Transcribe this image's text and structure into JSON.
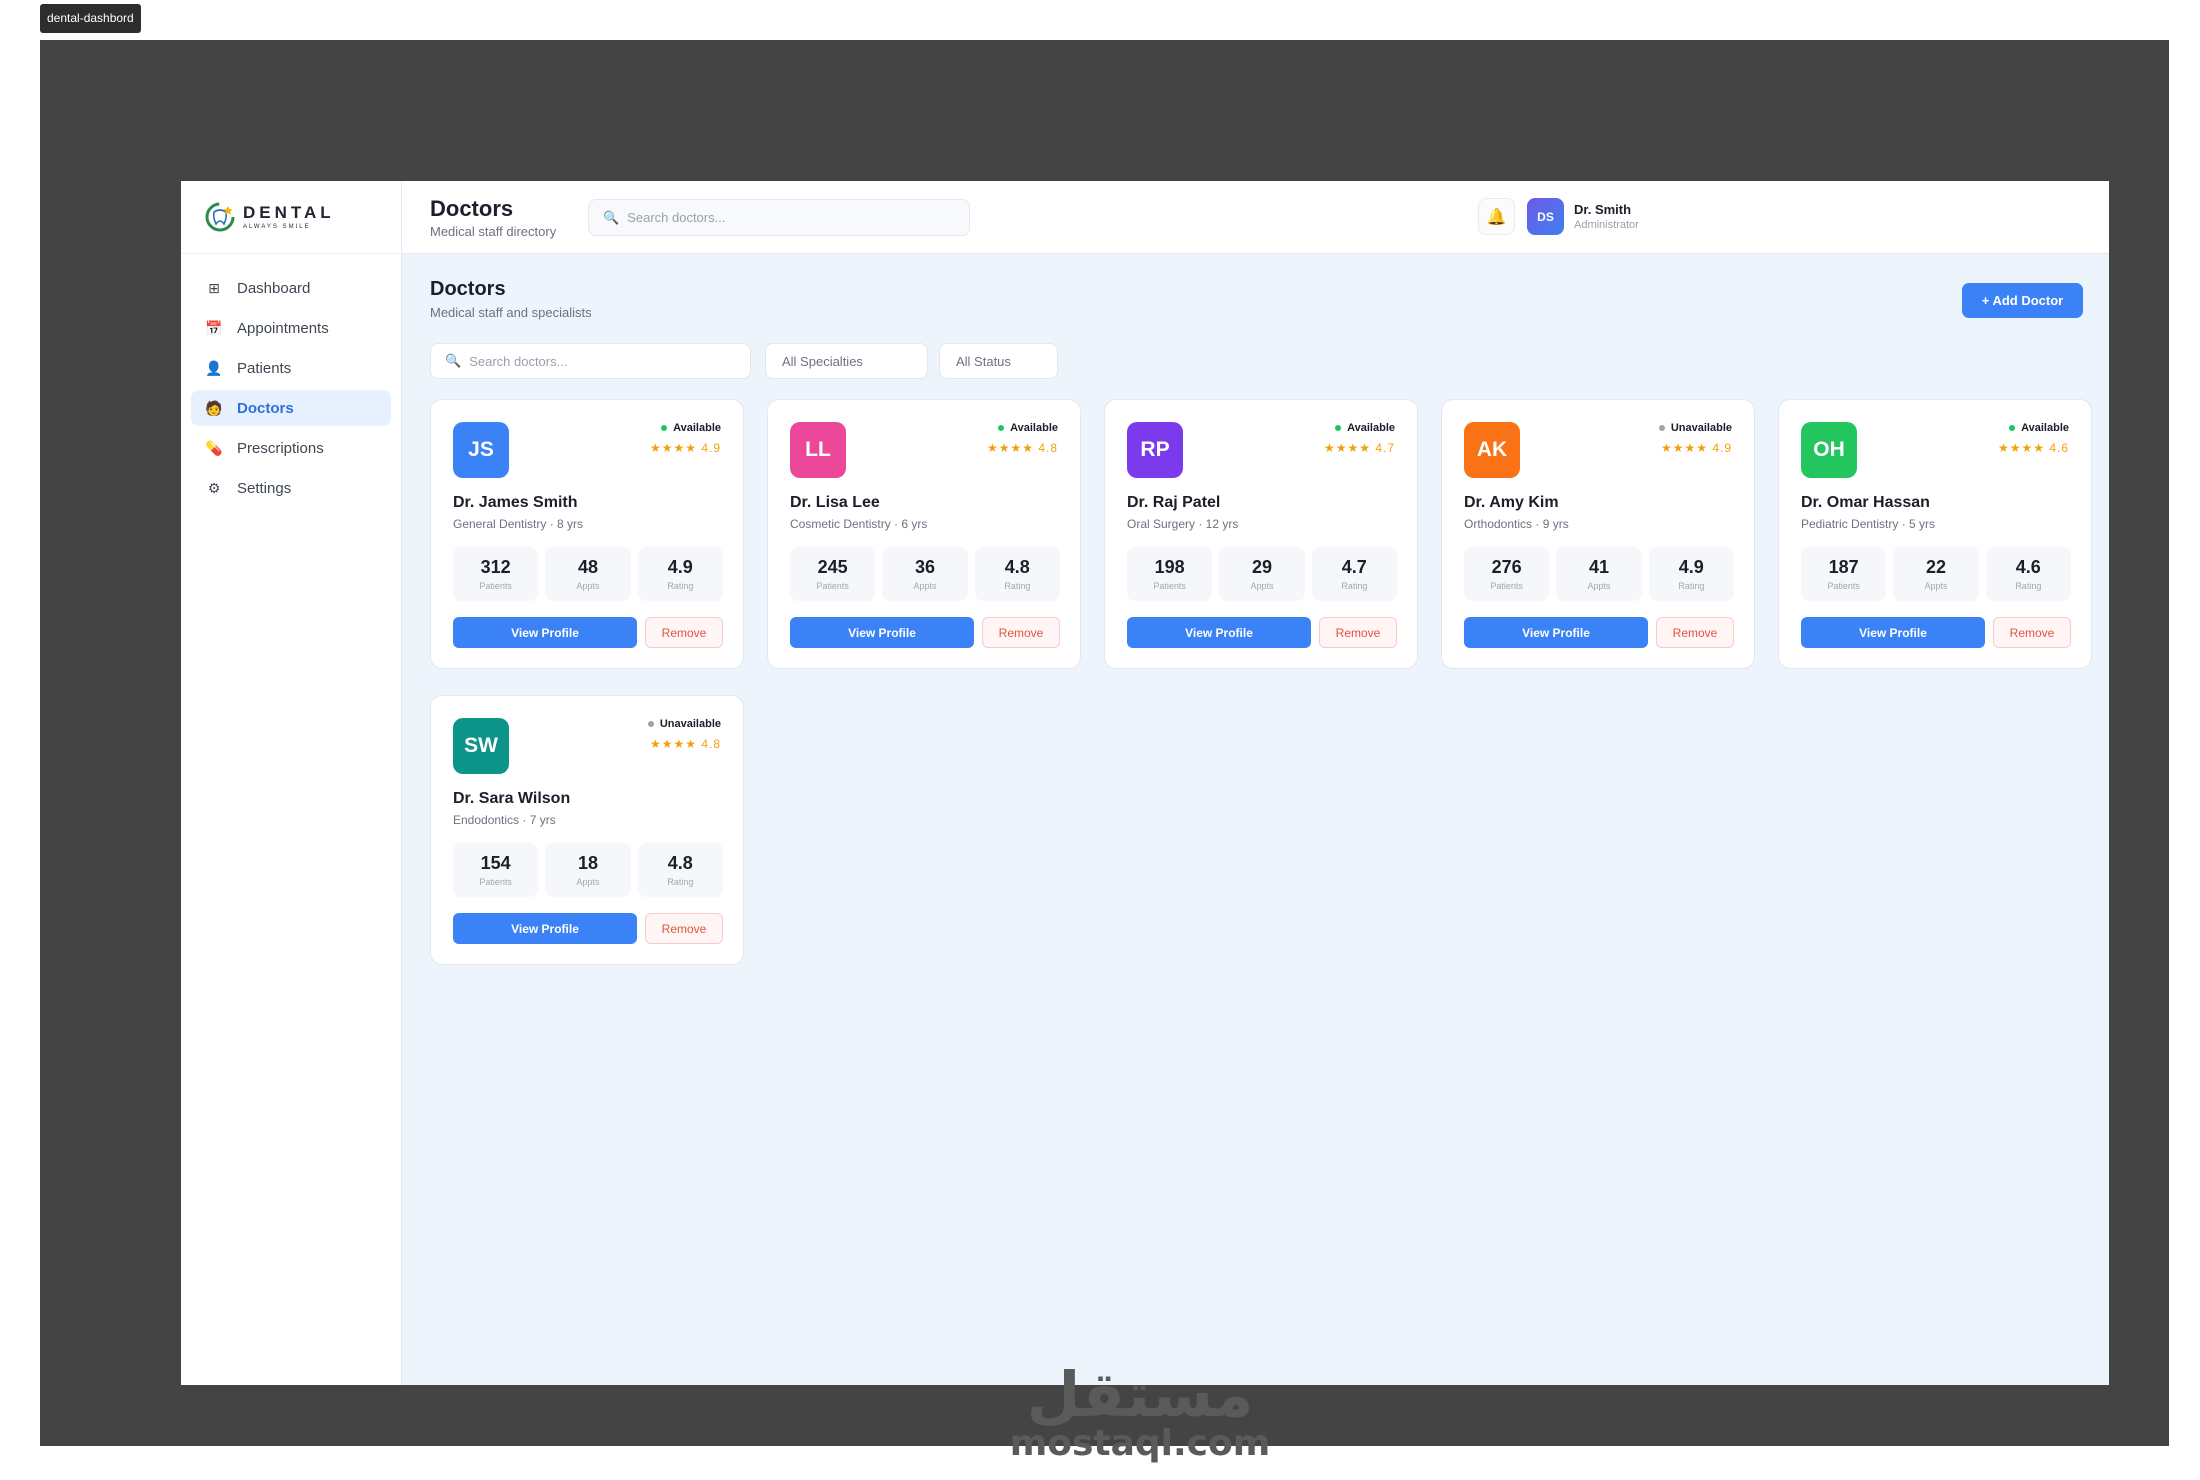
{
  "frame_tag": "dental-dashbord",
  "brand": {
    "name": "DENTAL",
    "tagline": "ALWAYS SMILE"
  },
  "sidebar": {
    "items": [
      {
        "label": "Dashboard",
        "icon": "grid-icon",
        "glyph": "⊞",
        "active": false
      },
      {
        "label": "Appointments",
        "icon": "calendar-icon",
        "glyph": "📅",
        "active": false
      },
      {
        "label": "Patients",
        "icon": "user-icon",
        "glyph": "👤",
        "active": false
      },
      {
        "label": "Doctors",
        "icon": "doctor-icon",
        "glyph": "🧑",
        "active": true
      },
      {
        "label": "Prescriptions",
        "icon": "pill-icon",
        "glyph": "💊",
        "active": false
      },
      {
        "label": "Settings",
        "icon": "gear-icon",
        "glyph": "⚙",
        "active": false
      }
    ]
  },
  "topbar": {
    "title": "Doctors",
    "subtitle": "Medical staff directory",
    "search_placeholder": "Search doctors...",
    "user": {
      "initials": "DS",
      "name": "Dr. Smith",
      "role": "Administrator"
    }
  },
  "main": {
    "title": "Doctors",
    "subtitle": "Medical staff and specialists",
    "add_label": "+ Add Doctor",
    "search_placeholder": "Search doctors...",
    "specialty_filter": "All Specialties",
    "status_filter": "All Status"
  },
  "card_labels": {
    "patients": "Patients",
    "appts": "Appts",
    "rating": "Rating",
    "view": "View Profile",
    "remove": "Remove"
  },
  "colors": {
    "accent": "#3b82f6",
    "available": "#22c55e",
    "unavailable": "#9ca3af",
    "star": "#f59e0b"
  },
  "doctors": [
    {
      "initials": "JS",
      "color": "#3b82f6",
      "status": "Available",
      "available": true,
      "stars": "★★★★",
      "rating_text": "4.9",
      "name": "Dr. James Smith",
      "specialty": "General Dentistry · 8 yrs",
      "patients": "312",
      "appts": "48",
      "rating": "4.9"
    },
    {
      "initials": "LL",
      "color": "#ec4899",
      "status": "Available",
      "available": true,
      "stars": "★★★★",
      "rating_text": "4.8",
      "name": "Dr. Lisa Lee",
      "specialty": "Cosmetic Dentistry · 6 yrs",
      "patients": "245",
      "appts": "36",
      "rating": "4.8"
    },
    {
      "initials": "RP",
      "color": "#7c3aed",
      "status": "Available",
      "available": true,
      "stars": "★★★★",
      "rating_text": "4.7",
      "name": "Dr. Raj Patel",
      "specialty": "Oral Surgery · 12 yrs",
      "patients": "198",
      "appts": "29",
      "rating": "4.7"
    },
    {
      "initials": "AK",
      "color": "#f97316",
      "status": "Unavailable",
      "available": false,
      "stars": "★★★★",
      "rating_text": "4.9",
      "name": "Dr. Amy Kim",
      "specialty": "Orthodontics · 9 yrs",
      "patients": "276",
      "appts": "41",
      "rating": "4.9"
    },
    {
      "initials": "OH",
      "color": "#22c55e",
      "status": "Available",
      "available": true,
      "stars": "★★★★",
      "rating_text": "4.6",
      "name": "Dr. Omar Hassan",
      "specialty": "Pediatric Dentistry · 5 yrs",
      "patients": "187",
      "appts": "22",
      "rating": "4.6"
    },
    {
      "initials": "SW",
      "color": "#0d9488",
      "status": "Unavailable",
      "available": false,
      "stars": "★★★★",
      "rating_text": "4.8",
      "name": "Dr. Sara Wilson",
      "specialty": "Endodontics · 7 yrs",
      "patients": "154",
      "appts": "18",
      "rating": "4.8"
    }
  ],
  "watermark": {
    "arabic": "مستقل",
    "latin": "mostaql.com"
  }
}
